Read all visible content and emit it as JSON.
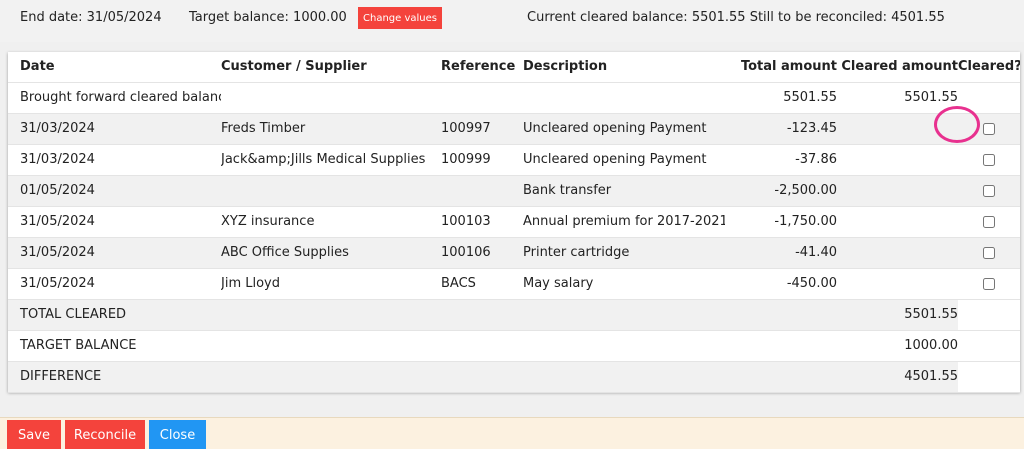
{
  "header": {
    "end_date": "End date: 31/05/2024",
    "target_balance": "Target balance: 1000.00",
    "change_values_label": "Change values",
    "balance_summary": "Current cleared balance: 5501.55 Still to be reconciled: 4501.55"
  },
  "table": {
    "columns": [
      "Date",
      "Customer / Supplier",
      "Reference",
      "Description",
      "Total amount",
      "Cleared amount",
      "Cleared?"
    ],
    "brought_forward": {
      "label": "Brought forward cleared balance",
      "total": "5501.55",
      "cleared": "5501.55"
    },
    "rows": [
      {
        "date": "31/03/2024",
        "party": "Freds Timber",
        "ref": "100997",
        "desc": "Uncleared opening Payment",
        "total": "-123.45",
        "checked": false
      },
      {
        "date": "31/03/2024",
        "party": "Jack&amp;Jills Medical Supplies",
        "ref": "100999",
        "desc": "Uncleared opening Payment",
        "total": "-37.86",
        "checked": false
      },
      {
        "date": "01/05/2024",
        "party": "",
        "ref": "",
        "desc": "Bank transfer",
        "total": "-2,500.00",
        "checked": false
      },
      {
        "date": "31/05/2024",
        "party": "XYZ insurance",
        "ref": "100103",
        "desc": "Annual premium for 2017-2021",
        "total": "-1,750.00",
        "checked": false
      },
      {
        "date": "31/05/2024",
        "party": "ABC Office Supplies",
        "ref": "100106",
        "desc": "Printer cartridge",
        "total": "-41.40",
        "checked": false
      },
      {
        "date": "31/05/2024",
        "party": "Jim Lloyd",
        "ref": "BACS",
        "desc": "May salary",
        "total": "-450.00",
        "checked": false
      }
    ],
    "summary": [
      {
        "label": "TOTAL CLEARED",
        "value": "5501.55"
      },
      {
        "label": "TARGET BALANCE",
        "value": "1000.00"
      },
      {
        "label": "DIFFERENCE",
        "value": "4501.55"
      }
    ]
  },
  "footer": {
    "save_label": "Save",
    "reconcile_label": "Reconcile",
    "close_label": "Close"
  },
  "colors": {
    "red": "#f4433c",
    "blue": "#2196f3",
    "highlight": "#e8318f",
    "footer_bg": "#fcf1e0"
  }
}
